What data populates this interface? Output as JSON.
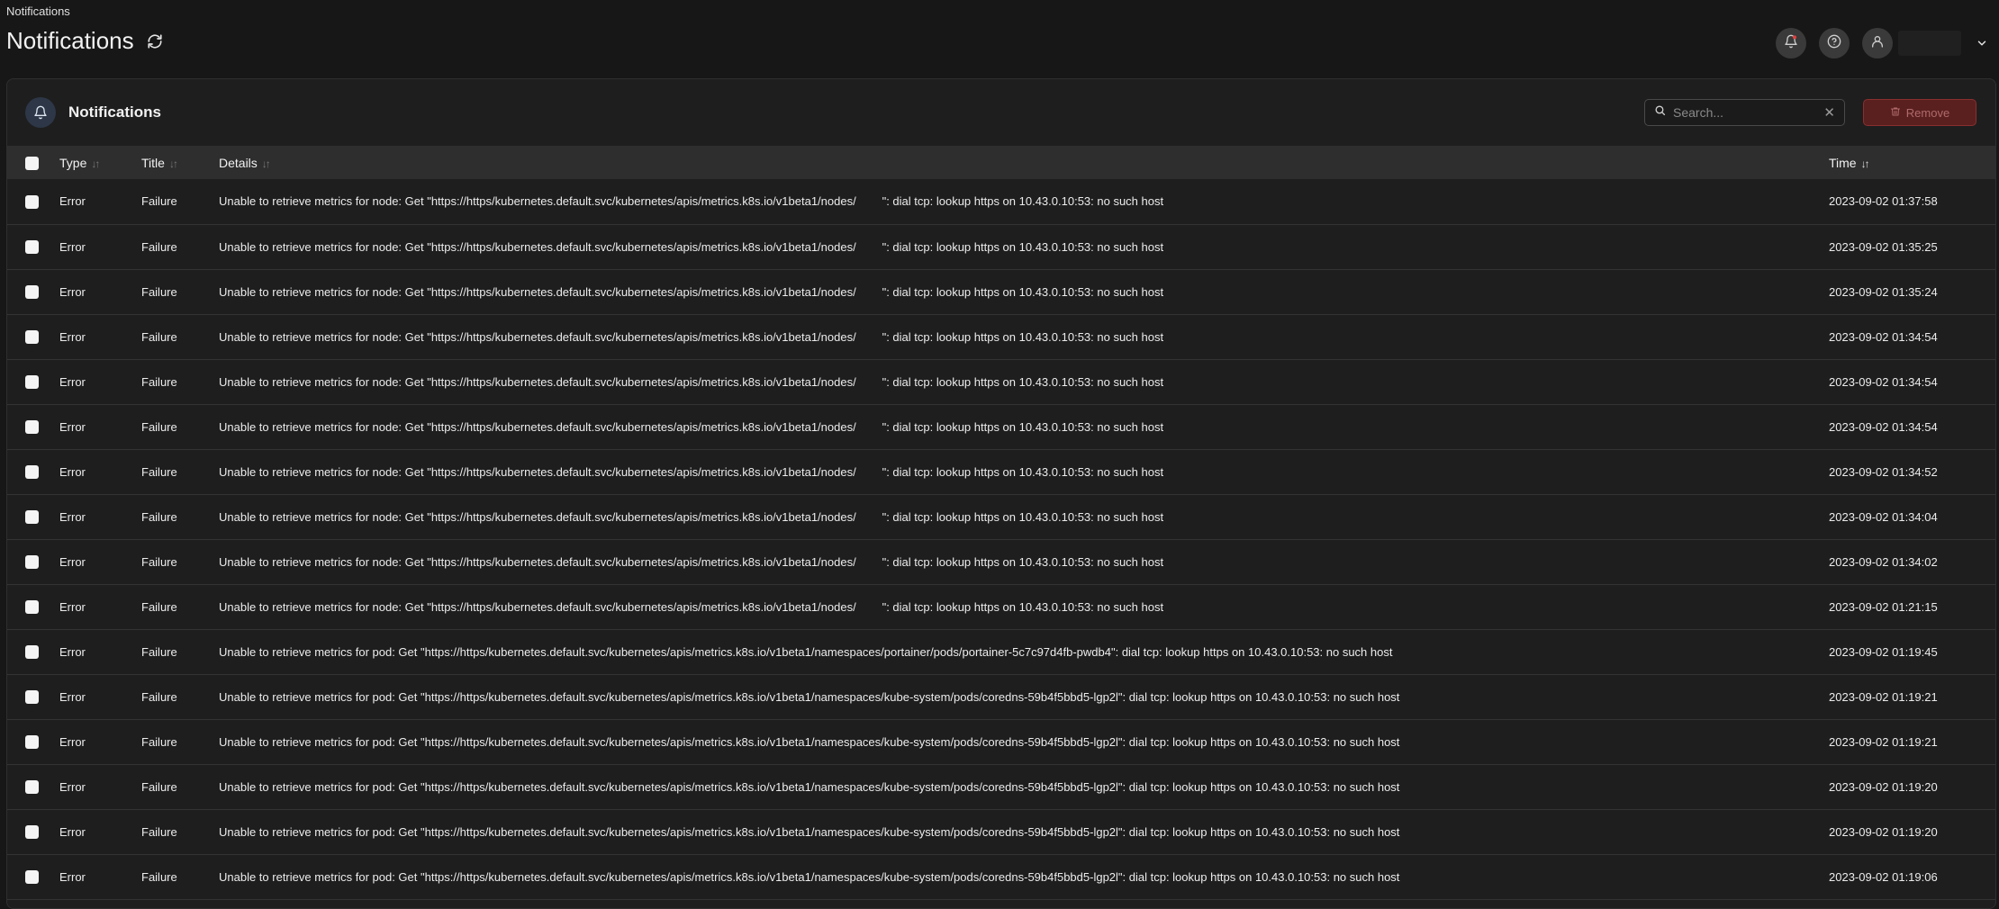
{
  "breadcrumb": "Notifications",
  "page_title": "Notifications",
  "panel": {
    "title": "Notifications",
    "search_placeholder": "Search...",
    "search_value": "",
    "remove_label": "Remove"
  },
  "columns": {
    "type": "Type",
    "title": "Title",
    "details": "Details",
    "time": "Time"
  },
  "rows": [
    {
      "type": "Error",
      "title": "Failure",
      "details": "Unable to retrieve metrics for node: Get \"https://https/kubernetes.default.svc/kubernetes/apis/metrics.k8s.io/v1beta1/nodes/        \": dial tcp: lookup https on 10.43.0.10:53: no such host",
      "time": "2023-09-02 01:37:58"
    },
    {
      "type": "Error",
      "title": "Failure",
      "details": "Unable to retrieve metrics for node: Get \"https://https/kubernetes.default.svc/kubernetes/apis/metrics.k8s.io/v1beta1/nodes/        \": dial tcp: lookup https on 10.43.0.10:53: no such host",
      "time": "2023-09-02 01:35:25"
    },
    {
      "type": "Error",
      "title": "Failure",
      "details": "Unable to retrieve metrics for node: Get \"https://https/kubernetes.default.svc/kubernetes/apis/metrics.k8s.io/v1beta1/nodes/        \": dial tcp: lookup https on 10.43.0.10:53: no such host",
      "time": "2023-09-02 01:35:24"
    },
    {
      "type": "Error",
      "title": "Failure",
      "details": "Unable to retrieve metrics for node: Get \"https://https/kubernetes.default.svc/kubernetes/apis/metrics.k8s.io/v1beta1/nodes/        \": dial tcp: lookup https on 10.43.0.10:53: no such host",
      "time": "2023-09-02 01:34:54"
    },
    {
      "type": "Error",
      "title": "Failure",
      "details": "Unable to retrieve metrics for node: Get \"https://https/kubernetes.default.svc/kubernetes/apis/metrics.k8s.io/v1beta1/nodes/        \": dial tcp: lookup https on 10.43.0.10:53: no such host",
      "time": "2023-09-02 01:34:54"
    },
    {
      "type": "Error",
      "title": "Failure",
      "details": "Unable to retrieve metrics for node: Get \"https://https/kubernetes.default.svc/kubernetes/apis/metrics.k8s.io/v1beta1/nodes/        \": dial tcp: lookup https on 10.43.0.10:53: no such host",
      "time": "2023-09-02 01:34:54"
    },
    {
      "type": "Error",
      "title": "Failure",
      "details": "Unable to retrieve metrics for node: Get \"https://https/kubernetes.default.svc/kubernetes/apis/metrics.k8s.io/v1beta1/nodes/        \": dial tcp: lookup https on 10.43.0.10:53: no such host",
      "time": "2023-09-02 01:34:52"
    },
    {
      "type": "Error",
      "title": "Failure",
      "details": "Unable to retrieve metrics for node: Get \"https://https/kubernetes.default.svc/kubernetes/apis/metrics.k8s.io/v1beta1/nodes/        \": dial tcp: lookup https on 10.43.0.10:53: no such host",
      "time": "2023-09-02 01:34:04"
    },
    {
      "type": "Error",
      "title": "Failure",
      "details": "Unable to retrieve metrics for node: Get \"https://https/kubernetes.default.svc/kubernetes/apis/metrics.k8s.io/v1beta1/nodes/        \": dial tcp: lookup https on 10.43.0.10:53: no such host",
      "time": "2023-09-02 01:34:02"
    },
    {
      "type": "Error",
      "title": "Failure",
      "details": "Unable to retrieve metrics for node: Get \"https://https/kubernetes.default.svc/kubernetes/apis/metrics.k8s.io/v1beta1/nodes/        \": dial tcp: lookup https on 10.43.0.10:53: no such host",
      "time": "2023-09-02 01:21:15"
    },
    {
      "type": "Error",
      "title": "Failure",
      "details": "Unable to retrieve metrics for pod: Get \"https://https/kubernetes.default.svc/kubernetes/apis/metrics.k8s.io/v1beta1/namespaces/portainer/pods/portainer-5c7c97d4fb-pwdb4\": dial tcp: lookup https on 10.43.0.10:53: no such host",
      "time": "2023-09-02 01:19:45"
    },
    {
      "type": "Error",
      "title": "Failure",
      "details": "Unable to retrieve metrics for pod: Get \"https://https/kubernetes.default.svc/kubernetes/apis/metrics.k8s.io/v1beta1/namespaces/kube-system/pods/coredns-59b4f5bbd5-lgp2l\": dial tcp: lookup https on 10.43.0.10:53: no such host",
      "time": "2023-09-02 01:19:21"
    },
    {
      "type": "Error",
      "title": "Failure",
      "details": "Unable to retrieve metrics for pod: Get \"https://https/kubernetes.default.svc/kubernetes/apis/metrics.k8s.io/v1beta1/namespaces/kube-system/pods/coredns-59b4f5bbd5-lgp2l\": dial tcp: lookup https on 10.43.0.10:53: no such host",
      "time": "2023-09-02 01:19:21"
    },
    {
      "type": "Error",
      "title": "Failure",
      "details": "Unable to retrieve metrics for pod: Get \"https://https/kubernetes.default.svc/kubernetes/apis/metrics.k8s.io/v1beta1/namespaces/kube-system/pods/coredns-59b4f5bbd5-lgp2l\": dial tcp: lookup https on 10.43.0.10:53: no such host",
      "time": "2023-09-02 01:19:20"
    },
    {
      "type": "Error",
      "title": "Failure",
      "details": "Unable to retrieve metrics for pod: Get \"https://https/kubernetes.default.svc/kubernetes/apis/metrics.k8s.io/v1beta1/namespaces/kube-system/pods/coredns-59b4f5bbd5-lgp2l\": dial tcp: lookup https on 10.43.0.10:53: no such host",
      "time": "2023-09-02 01:19:20"
    },
    {
      "type": "Error",
      "title": "Failure",
      "details": "Unable to retrieve metrics for pod: Get \"https://https/kubernetes.default.svc/kubernetes/apis/metrics.k8s.io/v1beta1/namespaces/kube-system/pods/coredns-59b4f5bbd5-lgp2l\": dial tcp: lookup https on 10.43.0.10:53: no such host",
      "time": "2023-09-02 01:19:06"
    }
  ],
  "icons": {
    "refresh": "refresh-icon",
    "notifications": "bell-icon",
    "help": "help-icon",
    "user": "user-icon",
    "chevron": "chevron-down-icon",
    "search": "search-icon",
    "clear": "close-icon",
    "remove": "trash-icon"
  },
  "colors": {
    "background": "#171717",
    "panel": "#1e1e1e",
    "header_row": "#2e2e2e",
    "danger": "#5a2020",
    "notification_dot": "#e03e3e"
  }
}
